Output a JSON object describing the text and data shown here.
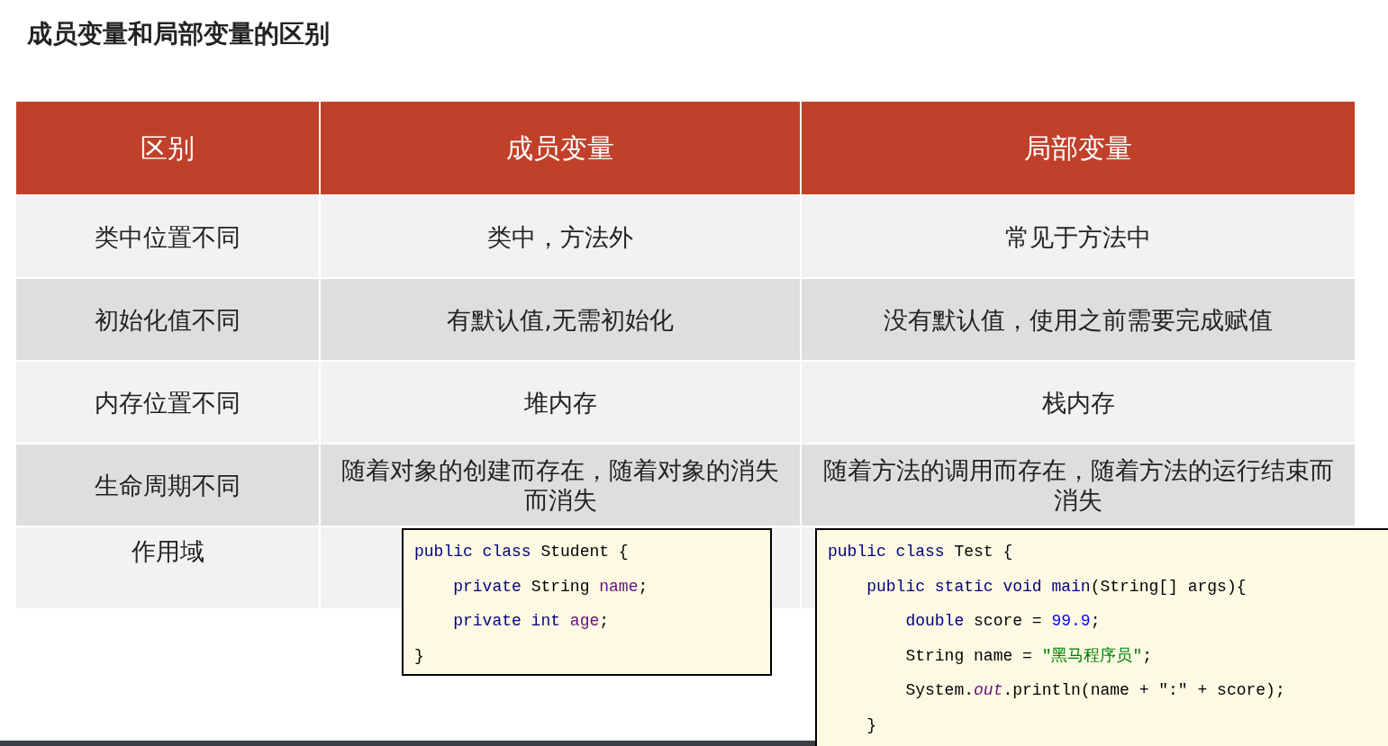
{
  "title": "成员变量和局部变量的区别",
  "table": {
    "columns": [
      "区别",
      "成员变量",
      "局部变量"
    ],
    "rows": [
      {
        "cells": [
          "类中位置不同",
          "类中，方法外",
          "常见于方法中"
        ]
      },
      {
        "cells": [
          "初始化值不同",
          "有默认值,无需初始化",
          "没有默认值，使用之前需要完成赋值"
        ]
      },
      {
        "cells": [
          "内存位置不同",
          "堆内存",
          "栈内存"
        ]
      },
      {
        "cells": [
          "生命周期不同",
          "随着对象的创建而存在，随着对象的消失而消失",
          "随着方法的调用而存在，随着方法的运行结束而消失"
        ]
      },
      {
        "cells": [
          "作用域"
        ]
      }
    ]
  },
  "code_blocks": [
    {
      "lines": [
        [
          {
            "text": "public class",
            "kind": "keyword"
          },
          {
            "text": " Student {",
            "kind": "plain"
          }
        ],
        [
          {
            "text": "    private",
            "kind": "keyword"
          },
          {
            "text": " String ",
            "kind": "plain"
          },
          {
            "text": "name",
            "kind": "field"
          },
          {
            "text": ";",
            "kind": "plain"
          }
        ],
        [
          {
            "text": "    private int",
            "kind": "keyword"
          },
          {
            "text": " age",
            "kind": "field"
          },
          {
            "text": ";",
            "kind": "plain"
          }
        ],
        [
          {
            "text": "}",
            "kind": "plain"
          }
        ]
      ]
    },
    {
      "lines": [
        [
          {
            "text": "public class",
            "kind": "keyword"
          },
          {
            "text": " Test {",
            "kind": "plain"
          }
        ],
        [
          {
            "text": "    public static void main",
            "kind": "keyword"
          },
          {
            "text": "(String[] args){",
            "kind": "plain"
          }
        ],
        [
          {
            "text": "        double",
            "kind": "keyword"
          },
          {
            "text": " score = ",
            "kind": "plain"
          },
          {
            "text": "99.9",
            "kind": "number"
          },
          {
            "text": ";",
            "kind": "plain"
          }
        ],
        [
          {
            "text": "        String name = ",
            "kind": "plain"
          },
          {
            "text": "\"黑马程序员\"",
            "kind": "string"
          },
          {
            "text": ";",
            "kind": "plain"
          }
        ],
        [
          {
            "text": "        System.",
            "kind": "plain"
          },
          {
            "text": "out",
            "kind": "static"
          },
          {
            "text": ".println(name + \":\" + score);",
            "kind": "plain"
          }
        ],
        [
          {
            "text": "    }",
            "kind": "plain"
          }
        ]
      ]
    }
  ]
}
